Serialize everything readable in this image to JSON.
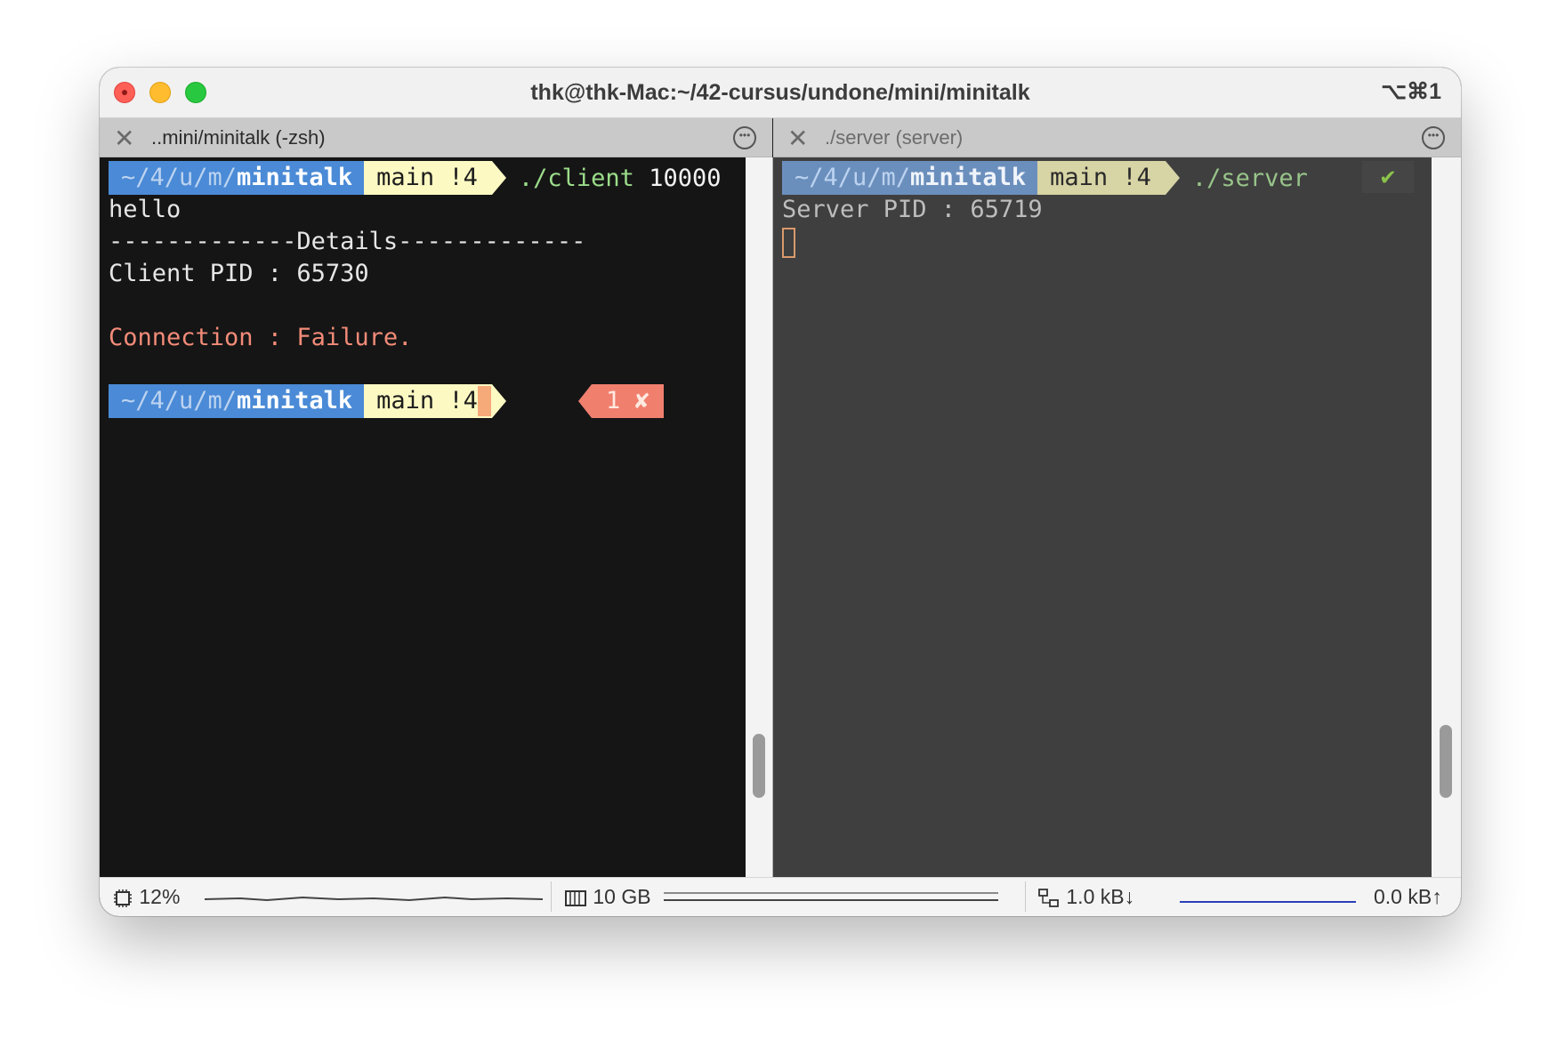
{
  "window": {
    "title": "thk@thk-Mac:~/42-cursus/undone/mini/minitalk",
    "shortcut": "⌥⌘1"
  },
  "tabs": [
    {
      "label": "..mini/minitalk (-zsh)",
      "close": "✕",
      "more": "•••"
    },
    {
      "label": "./server (server)",
      "close": "✕",
      "more": "•••"
    }
  ],
  "left_pane": {
    "prompt1": {
      "dir_dim": "~/4/u/m/",
      "dir_name": "minitalk",
      "git": "main !4",
      "command": "./client",
      "arg": "10000"
    },
    "lines": [
      "hello",
      "-------------Details-------------",
      "Client PID : 65730",
      "Connection : Failure."
    ],
    "prompt2": {
      "dir_dim": "~/4/u/m/",
      "dir_name": "minitalk",
      "git": "main !4"
    },
    "error_badge": "1 ✘"
  },
  "right_pane": {
    "prompt": {
      "dir_dim": "~/4/u/m/",
      "dir_name": "minitalk",
      "git": "main !4",
      "command": "./server",
      "status": "✔"
    },
    "lines": [
      "Server PID : 65719"
    ]
  },
  "statusbar": {
    "cpu": "12%",
    "memory": "10 GB",
    "net_down": "1.0 kB↓",
    "net_up": "0.0 kB↑"
  },
  "colors": {
    "error_red": "#f28b78",
    "dir_blue": "#4a8ad6",
    "git_yellow": "#fcf9c3",
    "cmd_green": "#9bdc8a"
  }
}
